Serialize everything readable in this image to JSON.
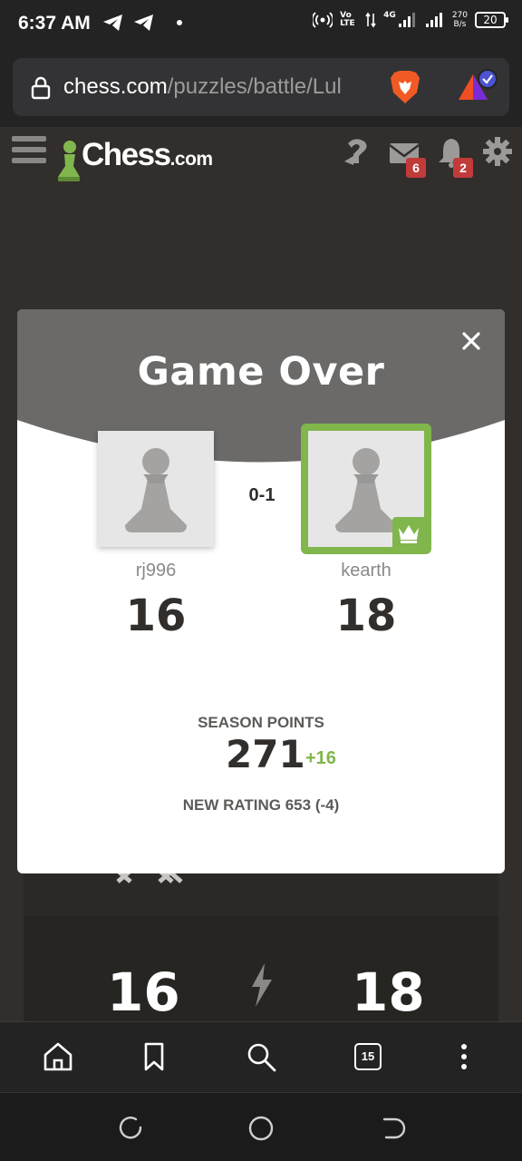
{
  "status_bar": {
    "time": "6:37 AM",
    "network_label": "Vo LTE",
    "net_type": "4G",
    "speed_value": "270",
    "speed_unit": "B/s",
    "battery": "20"
  },
  "browser": {
    "url_domain": "chess.com",
    "url_path": "/puzzles/battle/Lul",
    "tab_count": "15"
  },
  "header": {
    "logo_main": "Chess",
    "logo_suffix": ".com",
    "messages_badge": "6",
    "notifications_badge": "2"
  },
  "modal": {
    "title": "Game Over",
    "result": "0-1",
    "left_player": {
      "name": "rj996",
      "score": "16"
    },
    "right_player": {
      "name": "kearth",
      "score": "18"
    },
    "season_label": "SEASON POINTS",
    "season_points": "271",
    "season_delta": "+16",
    "new_rating": "NEW RATING 653 (-4)"
  },
  "background": {
    "left_score": "16",
    "right_score": "18"
  },
  "colors": {
    "accent_green": "#81b64c",
    "badge_red": "#c23b3b",
    "header_gray": "#6b6a68",
    "page_bg": "#312e2b"
  }
}
